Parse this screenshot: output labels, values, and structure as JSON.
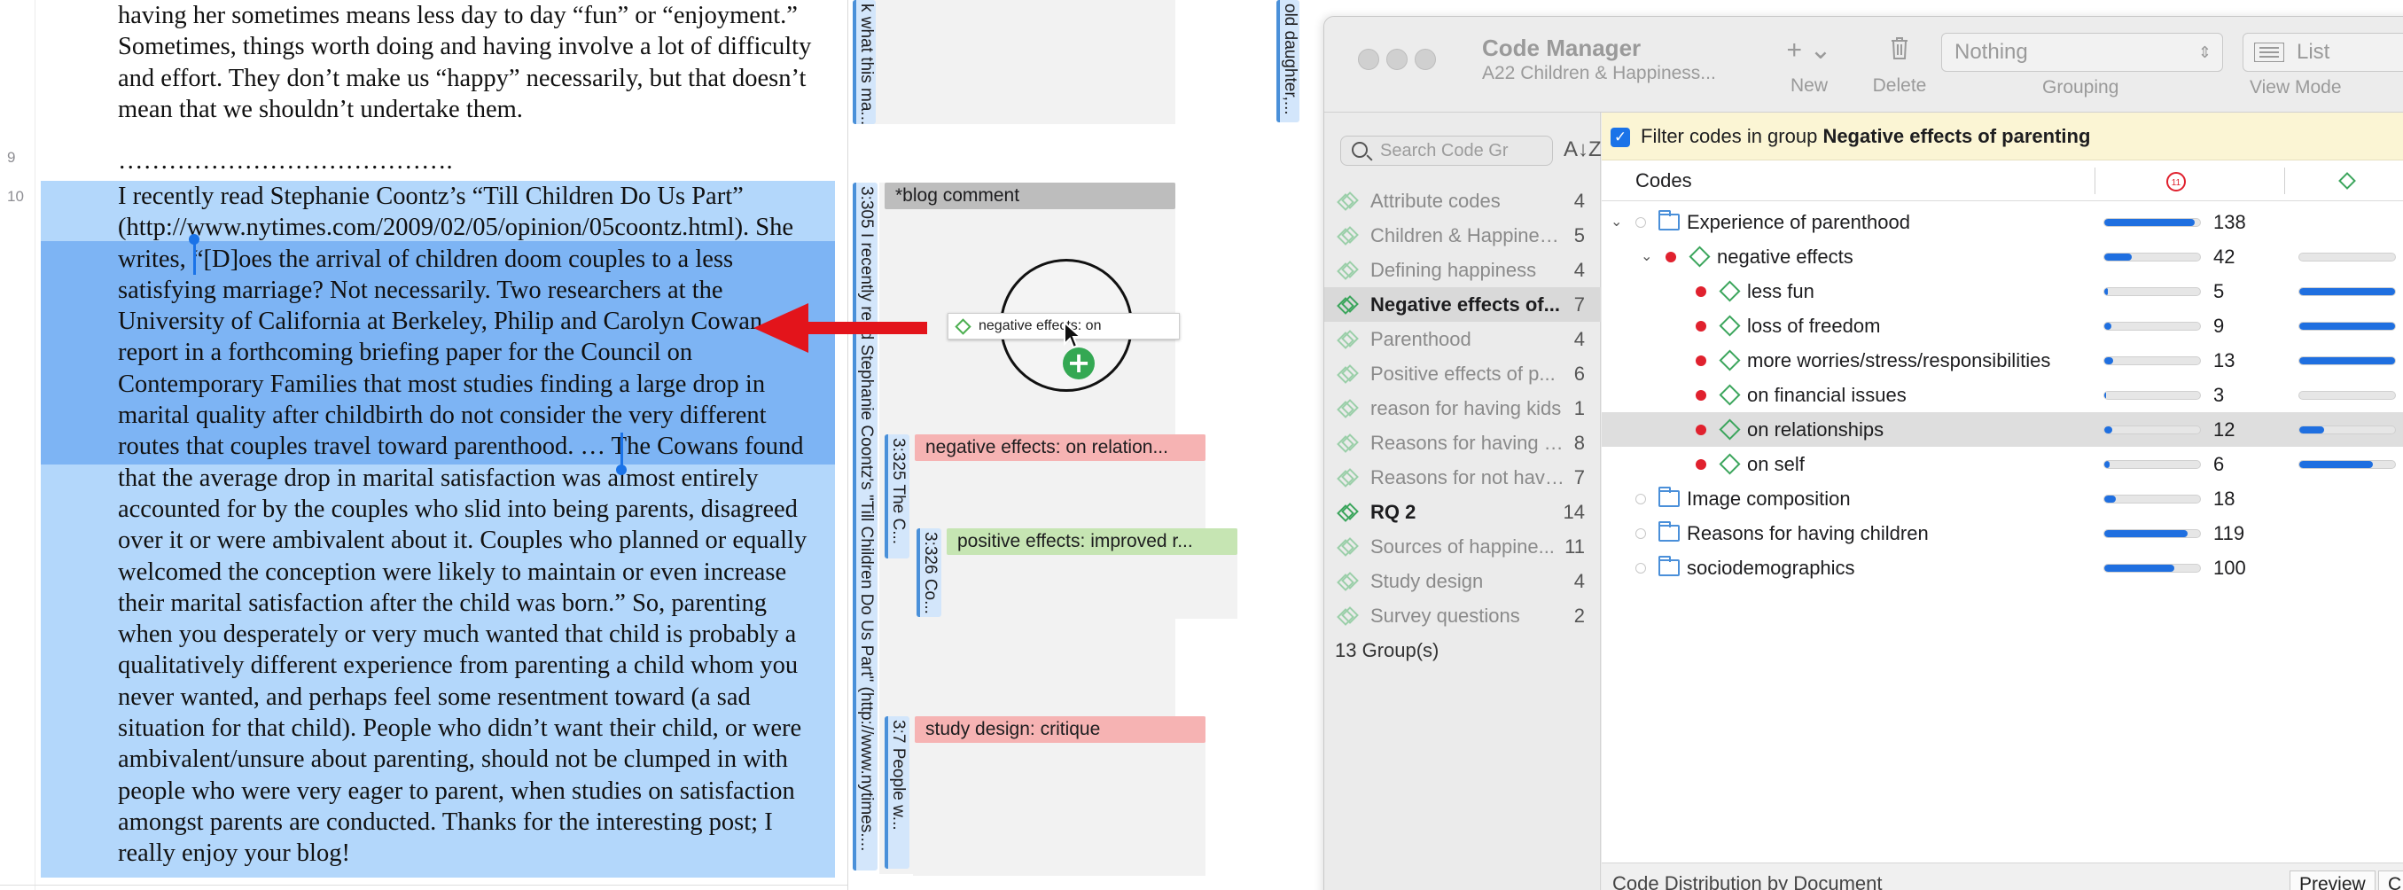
{
  "document": {
    "line_numbers": [
      "9",
      "10"
    ],
    "para_top_lines": [
      "having her sometimes means less day to day “fun” or “enjoyment.”",
      "Sometimes, things worth doing and having involve a lot of difficulty",
      "and effort. They don’t make us “happy” necessarily, but that doesn’t",
      "mean that we shouldn’t undertake them."
    ],
    "dots": "………………………………….",
    "para_main_lines": [
      "I recently read Stephanie Coontz’s “Till Children Do Us Part”",
      "(http://www.nytimes.com/2009/02/05/opinion/05coontz.html). She",
      "writes, “[D]oes the arrival of children doom couples to a less",
      "satisfying marriage? Not necessarily. Two researchers at the",
      "University of California at Berkeley, Philip and Carolyn Cowan",
      "report in a forthcoming briefing paper for the Council on",
      "Contemporary Families that most studies finding a large drop in",
      "marital quality after childbirth do not consider the very different",
      "routes that couples travel toward parenthood. … The Cowans found",
      "that the average drop in marital satisfaction was almost entirely",
      "accounted for by the couples who slid into being parents, disagreed",
      "over it or were ambivalent about it. Couples who planned or equally",
      "welcomed the conception were likely to maintain or even increase",
      "their marital satisfaction after the child was born.” So, parenting",
      "when you desperately or very much wanted that child is probably a",
      "qualitatively different experience from parenting a child whom you",
      "never wanted, and perhaps feel some resentment toward (a sad",
      "situation for that child). People who didn’t want their child, or were",
      "ambivalent/unsure about parenting, should not be clumped in with",
      "people who were very eager to parent, when studies on satisfaction",
      "amongst parents are conducted. Thanks for the interesting post; I",
      "really enjoy your blog!"
    ]
  },
  "margin": {
    "quote_top": "k what this ma...",
    "quote_305": "3:305 I recently read Stephanie Coontz's \"Till Children Do Us Part\" (http://www.nytimes....",
    "quote_325": "3:325 The C...",
    "quote_326": "3:326 Co...",
    "quote_7": "3:7 People w...",
    "quote_far": "old daughter,...",
    "tag_blog": "*blog comment",
    "tag_neg": "negative effects: on relation...",
    "tag_pos": "positive effects: improved r...",
    "tag_study": "study design: critique",
    "drag_label": "negative effects: on"
  },
  "code_manager": {
    "title": "Code Manager",
    "subtitle": "A22 Children & Happiness...",
    "toolbar": {
      "new_label": "New",
      "delete_label": "Delete",
      "grouping_value": "Nothing",
      "grouping_label": "Grouping",
      "viewmode_value": "List",
      "viewmode_label": "View Mode"
    },
    "search_placeholder": "Search Code Gr",
    "groups": [
      {
        "name": "Attribute codes",
        "count": "4",
        "state": "normal"
      },
      {
        "name": "Children & Happines...",
        "count": "5",
        "state": "normal"
      },
      {
        "name": "Defining happiness",
        "count": "4",
        "state": "normal"
      },
      {
        "name": "Negative effects of...",
        "count": "7",
        "state": "active"
      },
      {
        "name": "Parenthood",
        "count": "4",
        "state": "normal"
      },
      {
        "name": "Positive effects of p...",
        "count": "6",
        "state": "normal"
      },
      {
        "name": "reason for having kids",
        "count": "1",
        "state": "normal"
      },
      {
        "name": "Reasons for having c...",
        "count": "8",
        "state": "normal"
      },
      {
        "name": "Reasons for not havi...",
        "count": "7",
        "state": "normal"
      },
      {
        "name": "RQ 2",
        "count": "14",
        "state": "bold"
      },
      {
        "name": "Sources of happine...",
        "count": "11",
        "state": "normal"
      },
      {
        "name": "Study design",
        "count": "4",
        "state": "normal"
      },
      {
        "name": "Survey questions",
        "count": "2",
        "state": "normal"
      }
    ],
    "group_count": "13 Group(s)",
    "filter_prefix": "Filter codes in group ",
    "filter_group": "Negative effects of parenting",
    "codes_header": "Codes",
    "col1_icon_value": "11",
    "codes": [
      {
        "name": "Experience of parenthood",
        "kind": "folder",
        "level": 0,
        "expanded": true,
        "col1": "138",
        "col1_frac": 0.93,
        "col2": "",
        "col2_frac": null,
        "dot": "empty",
        "selected": false
      },
      {
        "name": "negative effects",
        "kind": "code",
        "level": 1,
        "expanded": true,
        "col1": "42",
        "col1_frac": 0.28,
        "col2": "0",
        "col2_frac": 0.0,
        "dot": "red",
        "selected": false
      },
      {
        "name": "less fun",
        "kind": "code",
        "level": 2,
        "col1": "5",
        "col1_frac": 0.04,
        "col2": "4",
        "col2_frac": 1.0,
        "dot": "red",
        "selected": false
      },
      {
        "name": "loss of freedom",
        "kind": "code",
        "level": 2,
        "col1": "9",
        "col1_frac": 0.07,
        "col2": "4",
        "col2_frac": 1.0,
        "dot": "red",
        "selected": false
      },
      {
        "name": "more worries/stress/responsibilities",
        "kind": "code",
        "level": 2,
        "col1": "13",
        "col1_frac": 0.09,
        "col2": "4",
        "col2_frac": 1.0,
        "dot": "red",
        "selected": false
      },
      {
        "name": "on financial issues",
        "kind": "code",
        "level": 2,
        "col1": "3",
        "col1_frac": 0.02,
        "col2": "0",
        "col2_frac": 0.0,
        "dot": "red",
        "selected": false
      },
      {
        "name": "on relationships",
        "kind": "code",
        "level": 2,
        "col1": "12",
        "col1_frac": 0.08,
        "col2": "1",
        "col2_frac": 0.25,
        "dot": "red",
        "selected": true
      },
      {
        "name": "on self",
        "kind": "code",
        "level": 2,
        "col1": "6",
        "col1_frac": 0.05,
        "col2": "3",
        "col2_frac": 0.75,
        "dot": "red",
        "selected": false
      },
      {
        "name": "Image composition",
        "kind": "folder",
        "level": 0,
        "col1": "18",
        "col1_frac": 0.12,
        "col2": "",
        "col2_frac": null,
        "dot": "empty",
        "selected": false
      },
      {
        "name": "Reasons for having children",
        "kind": "folder",
        "level": 0,
        "col1": "119",
        "col1_frac": 0.85,
        "col2": "",
        "col2_frac": null,
        "dot": "empty",
        "selected": false
      },
      {
        "name": "sociodemographics",
        "kind": "folder",
        "level": 0,
        "col1": "100",
        "col1_frac": 0.72,
        "col2": "",
        "col2_frac": null,
        "dot": "empty",
        "selected": false
      }
    ],
    "distribution_label": "Code Distribution by Document",
    "preview_label": "Preview",
    "extra_tab_label": "C"
  },
  "colors": {
    "selection_light": "#b3d7fb",
    "selection_strong": "#7db4f4",
    "accent_blue": "#1f6fe0",
    "code_green": "#3ba55c",
    "red_dot": "#e0212e",
    "arrow_red": "#e3141b",
    "filter_bg": "#fbf5d4"
  },
  "icons": {
    "new": "plus-icon",
    "delete": "trash-icon",
    "search": "search-icon",
    "sort": "sort-az-icon",
    "folder": "folder-icon",
    "code": "diamond-code-icon",
    "add": "plus-circle-icon"
  }
}
